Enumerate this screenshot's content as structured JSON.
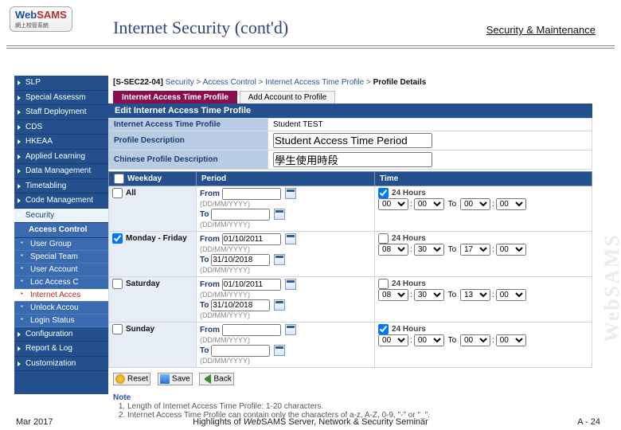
{
  "logo": {
    "brand1": "Web",
    "brand2": "SAMS",
    "chinese": "網上校管系統"
  },
  "title": "Internet Security (cont'd)",
  "subtitle": "Security & Maintenance",
  "vertical_brand": "WebSAMS",
  "sidebar": {
    "top_items": [
      "SLP",
      "Special Assessm",
      "Staff Deployment",
      "CDS",
      "HKEAA",
      "Applied Learning",
      "Data Management",
      "Timetabling",
      "Code Management"
    ],
    "security_label": "Security",
    "ac_label": "Access Control",
    "ac_sub": [
      "User Group",
      "Special Team",
      "User Account",
      "Loc Access C",
      "Internet Acces",
      "Unlock Accou",
      "Login Status"
    ],
    "bottom_items": [
      "Configuration",
      "Report & Log",
      "Customization"
    ]
  },
  "breadcrumb": {
    "code": "[S-SEC22-04]",
    "a": "Security",
    "b": "Access Control",
    "c": "Internet Access Time Profile",
    "cur": "Profile Details"
  },
  "tabs": {
    "active": "Internet Access Time Profile",
    "inactive": "Add Account to Profile"
  },
  "section_title": "Edit Internet Access Time Profile",
  "pairs": [
    {
      "label": "Internet Access Time Profile",
      "value": "Student TEST"
    },
    {
      "label": "Profile Description",
      "value": "Student Access Time Period"
    },
    {
      "label": "Chinese Profile Description",
      "value": "學生使用時段"
    }
  ],
  "grid": {
    "headers": {
      "weekday": "Weekday",
      "period": "Period",
      "time": "Time"
    },
    "check_all_label": "All",
    "from_label": "From",
    "to_label": "To",
    "date_hint": "(DD/MM/YYYY)",
    "h24_label": "24 Hours",
    "rows": [
      {
        "label": "All",
        "checked": false,
        "from": "",
        "to": "",
        "h24": true,
        "t": [
          "00",
          "00",
          "00",
          "00"
        ]
      },
      {
        "label": "Monday - Friday",
        "checked": true,
        "from": "01/10/2011",
        "to": "31/10/2018",
        "h24": false,
        "t": [
          "08",
          "30",
          "17",
          "00"
        ]
      },
      {
        "label": "Saturday",
        "checked": false,
        "from": "01/10/2011",
        "to": "31/10/2018",
        "h24": false,
        "t": [
          "08",
          "30",
          "13",
          "00"
        ]
      },
      {
        "label": "Sunday",
        "checked": false,
        "from": "",
        "to": "",
        "h24": true,
        "t": [
          "00",
          "00",
          "00",
          "00"
        ]
      }
    ]
  },
  "buttons": {
    "reset": "Reset",
    "save": "Save",
    "back": "Back"
  },
  "notes": {
    "header": "Note",
    "items": [
      "Length of Internet Access Time Profile: 1-20 characters.",
      "Internet Access Time Profile can contain only the characters of a-z, A-Z, 0-9, \"-\" or \"_\"."
    ]
  },
  "footer": {
    "left": "Mar 2017",
    "center_prefix": "Highlights of ",
    "center_em": "Web",
    "center_suffix": "SAMS Server, Network & Security Seminar",
    "right": "A - 24"
  }
}
